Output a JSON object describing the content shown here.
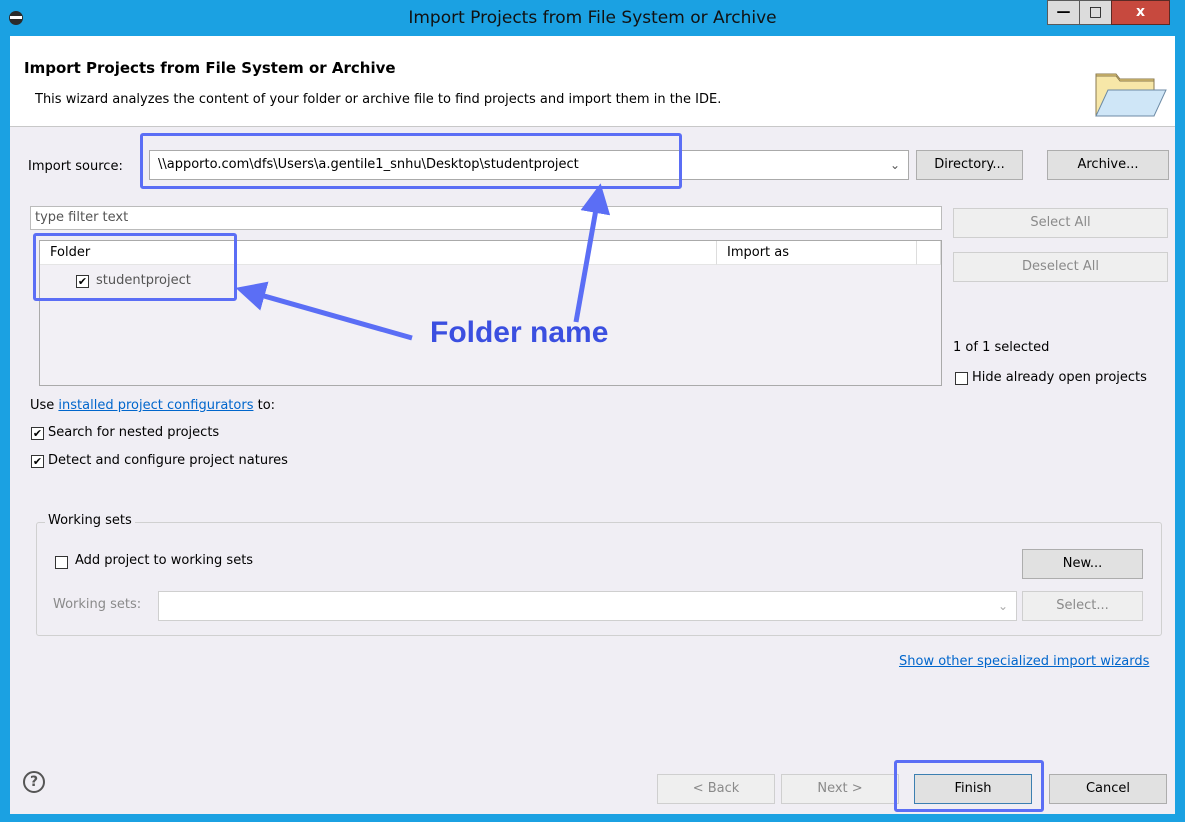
{
  "window": {
    "title": "Import Projects from File System or Archive",
    "minimize": "—",
    "maximize": "□",
    "close": "x"
  },
  "header": {
    "title": "Import Projects from File System or Archive",
    "description": "This wizard analyzes the content of your folder or archive file to find projects and import them in the IDE."
  },
  "import_source": {
    "label": "Import source:",
    "value": "\\\\apporto.com\\dfs\\Users\\a.gentile1_snhu\\Desktop\\studentproject",
    "directory_button": "Directory...",
    "archive_button": "Archive..."
  },
  "filter": {
    "placeholder": "type filter text"
  },
  "table": {
    "col_folder": "Folder",
    "col_import_as": "Import as",
    "rows": [
      {
        "name": "studentproject",
        "checked": true
      }
    ]
  },
  "side": {
    "select_all": "Select All",
    "deselect_all": "Deselect All",
    "selection_count": "1 of 1 selected",
    "hide_open": "Hide already open projects"
  },
  "configurators": {
    "prefix": "Use ",
    "link": "installed project configurators",
    "suffix": " to:",
    "search_nested": "Search for nested projects",
    "detect_natures": "Detect and configure project natures"
  },
  "working_sets": {
    "legend": "Working sets",
    "add_label": "Add project to working sets",
    "new_button": "New...",
    "sets_label": "Working sets:",
    "select_button": "Select..."
  },
  "other_wizards_link": "Show other specialized import wizards",
  "footer": {
    "help": "?",
    "back": "< Back",
    "next": "Next >",
    "finish": "Finish",
    "cancel": "Cancel"
  },
  "annotation": {
    "text": "Folder name",
    "color": "#5b6ef5"
  }
}
